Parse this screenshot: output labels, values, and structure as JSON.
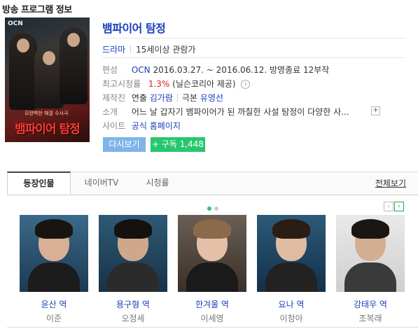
{
  "page_heading": "방송 프로그램 정보",
  "poster": {
    "logo": "OCN",
    "tagline": "모완벽한 해결 수사극",
    "title": "뱀파이어 탐정"
  },
  "program": {
    "title": "뱀파이어 탐정",
    "genre": "드라마",
    "rating_age": "15세이상 관람가",
    "broadcast": {
      "label": "편성",
      "channel": "OCN",
      "period": "2016.03.27. ~ 2016.06.12. 방영종료 12부작"
    },
    "max_rating": {
      "label": "최고시청률",
      "value": "1.3%",
      "source": "(닐슨코리아 제공)",
      "info_icon": "i"
    },
    "staff": {
      "label": "제작진",
      "director_label": "연출",
      "director": "김가람",
      "writer_label": "극본",
      "writer": "유영선"
    },
    "synopsis": {
      "label": "소개",
      "text": "어느 날 갑자기 뱀파이어가 된 까칠한 사설 탐정이 다양한 사...",
      "expand_icon": "+"
    },
    "site": {
      "label": "사이트",
      "link": "공식 홈페이지"
    }
  },
  "buttons": {
    "watch_again": "다시보기",
    "subscribe": "+ 구독 1,448"
  },
  "tabs": [
    {
      "label": "등장인물",
      "active": true
    },
    {
      "label": "네이버TV",
      "active": false
    },
    {
      "label": "시청률",
      "active": false
    }
  ],
  "view_all": "전체보기",
  "carousel": {
    "pages": 2,
    "current_page": 1,
    "prev_icon": "‹",
    "next_icon": "›"
  },
  "cast": [
    {
      "role": "윤산 역",
      "actor": "이준"
    },
    {
      "role": "용구형 역",
      "actor": "오정세"
    },
    {
      "role": "한겨울 역",
      "actor": "이세영"
    },
    {
      "role": "요나 역",
      "actor": "이청아"
    },
    {
      "role": "강태우 역",
      "actor": "조복래"
    }
  ],
  "colors": {
    "link_blue": "#1a3dbb",
    "rating_red": "#d52121",
    "watch_button": "#7fb4e8",
    "subscribe_button": "#28c76f"
  }
}
